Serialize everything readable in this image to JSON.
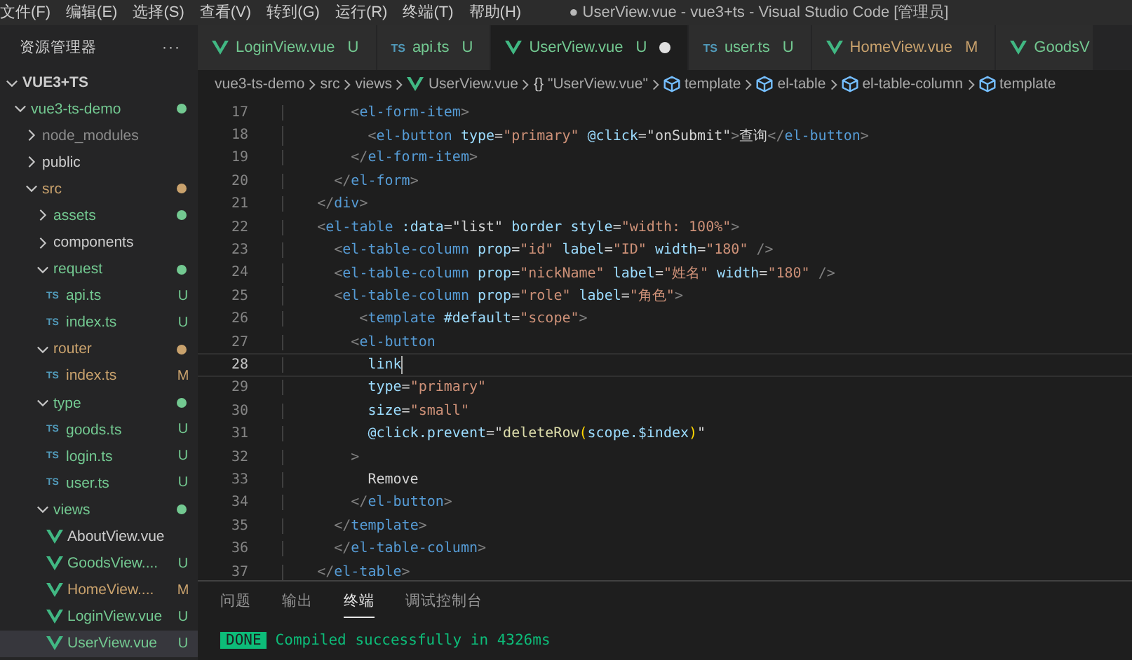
{
  "menu_bar": {
    "items": [
      "文件(F)",
      "编辑(E)",
      "选择(S)",
      "查看(V)",
      "转到(G)",
      "运行(R)",
      "终端(T)",
      "帮助(H)"
    ],
    "window_title": "● UserView.vue - vue3+ts - Visual Studio Code [管理员]"
  },
  "explorer": {
    "title": "资源管理器",
    "more": "···",
    "section": {
      "title": "VUE3+TS",
      "expanded": true
    },
    "tree": [
      {
        "label": "vue3-ts-demo",
        "kind": "folder",
        "expanded": true,
        "dot": true,
        "color": "#73c991",
        "selected": false,
        "children": [
          {
            "label": "node_modules",
            "kind": "folder",
            "expanded": false,
            "dot": false,
            "color": "#8c8c8c",
            "selected": false
          },
          {
            "label": "public",
            "kind": "folder",
            "expanded": false,
            "dot": false,
            "color": "#cccccc",
            "selected": false
          },
          {
            "label": "src",
            "kind": "folder",
            "expanded": true,
            "dot": true,
            "color": "#c9a26d",
            "selected": false,
            "children": [
              {
                "label": "assets",
                "kind": "folder",
                "expanded": false,
                "dot": true,
                "color": "#73c991",
                "selected": false
              },
              {
                "label": "components",
                "kind": "folder",
                "expanded": false,
                "dot": false,
                "color": "#cccccc",
                "selected": false
              },
              {
                "label": "request",
                "kind": "folder",
                "expanded": true,
                "dot": true,
                "color": "#73c991",
                "selected": false,
                "children": [
                  {
                    "label": "api.ts",
                    "kind": "ts",
                    "icon_label": "TS",
                    "badge": "U",
                    "color": "#73c991",
                    "selected": false
                  },
                  {
                    "label": "index.ts",
                    "kind": "ts",
                    "icon_label": "TS",
                    "badge": "U",
                    "color": "#73c991",
                    "selected": false
                  }
                ]
              },
              {
                "label": "router",
                "kind": "folder",
                "expanded": true,
                "dot": true,
                "color": "#c9a26d",
                "selected": false,
                "children": [
                  {
                    "label": "index.ts",
                    "kind": "ts",
                    "icon_label": "TS",
                    "badge": "M",
                    "color": "#c9a26d",
                    "selected": false
                  }
                ]
              },
              {
                "label": "type",
                "kind": "folder",
                "expanded": true,
                "dot": true,
                "color": "#73c991",
                "selected": false,
                "children": [
                  {
                    "label": "goods.ts",
                    "kind": "ts",
                    "icon_label": "TS",
                    "badge": "U",
                    "color": "#73c991",
                    "selected": false
                  },
                  {
                    "label": "login.ts",
                    "kind": "ts",
                    "icon_label": "TS",
                    "badge": "U",
                    "color": "#73c991",
                    "selected": false
                  },
                  {
                    "label": "user.ts",
                    "kind": "ts",
                    "icon_label": "TS",
                    "badge": "U",
                    "color": "#73c991",
                    "selected": false
                  }
                ]
              },
              {
                "label": "views",
                "kind": "folder",
                "expanded": true,
                "dot": true,
                "color": "#73c991",
                "selected": false,
                "children": [
                  {
                    "label": "AboutView.vue",
                    "kind": "vue",
                    "color": "#cccccc",
                    "selected": false
                  },
                  {
                    "label": "GoodsView....",
                    "kind": "vue",
                    "badge": "U",
                    "color": "#73c991",
                    "selected": false
                  },
                  {
                    "label": "HomeView....",
                    "kind": "vue",
                    "badge": "M",
                    "color": "#c9a26d",
                    "selected": false
                  },
                  {
                    "label": "LoginView.vue",
                    "kind": "vue",
                    "badge": "U",
                    "color": "#73c991",
                    "selected": false
                  },
                  {
                    "label": "UserView.vue",
                    "kind": "vue",
                    "badge": "U",
                    "color": "#73c991",
                    "selected": true
                  }
                ]
              }
            ]
          }
        ]
      }
    ]
  },
  "tabs": [
    {
      "label": "LoginView.vue",
      "kind": "vue",
      "badge": "U",
      "color": "#73c991",
      "selected": false,
      "dirty": false
    },
    {
      "label": "api.ts",
      "kind": "ts",
      "icon_label": "TS",
      "badge": "U",
      "color": "#73c991",
      "selected": false,
      "dirty": false
    },
    {
      "label": "UserView.vue",
      "kind": "vue",
      "badge": "U",
      "color": "#73c991",
      "selected": true,
      "dirty": true
    },
    {
      "label": "user.ts",
      "kind": "ts",
      "icon_label": "TS",
      "badge": "U",
      "color": "#73c991",
      "selected": false,
      "dirty": false
    },
    {
      "label": "HomeView.vue",
      "kind": "vue",
      "badge": "M",
      "color": "#c9a26d",
      "selected": false,
      "dirty": false
    },
    {
      "label": "GoodsV",
      "kind": "vue",
      "color": "#73c991",
      "selected": false,
      "dirty": false
    }
  ],
  "breadcrumb": [
    {
      "label": "vue3-ts-demo",
      "kind": "plain"
    },
    {
      "label": "src",
      "kind": "plain"
    },
    {
      "label": "views",
      "kind": "plain"
    },
    {
      "label": "UserView.vue",
      "kind": "vue"
    },
    {
      "label": "\"UserView.vue\"",
      "kind": "object",
      "icon_label": "{}"
    },
    {
      "label": "template",
      "kind": "element"
    },
    {
      "label": "el-table",
      "kind": "element"
    },
    {
      "label": "el-table-column",
      "kind": "element"
    },
    {
      "label": "template",
      "kind": "element"
    }
  ],
  "editor": {
    "lines": [
      {
        "number": "17",
        "current": false,
        "tokens": [
          {
            "kind": "punct",
            "text": "        <"
          },
          {
            "kind": "tag",
            "text": "el-form-item"
          },
          {
            "kind": "punct",
            "text": ">"
          }
        ]
      },
      {
        "number": "18",
        "current": false,
        "tokens": [
          {
            "kind": "punct",
            "text": "          <"
          },
          {
            "kind": "tag",
            "text": "el-button"
          },
          {
            "kind": "attr",
            "text": " type"
          },
          {
            "kind": "text",
            "text": "="
          },
          {
            "kind": "str",
            "text": "\"primary\""
          },
          {
            "kind": "attr",
            "text": " @click"
          },
          {
            "kind": "text",
            "text": "=\"onSubmit\""
          },
          {
            "kind": "punct",
            "text": ">"
          },
          {
            "kind": "text",
            "text": "查询"
          },
          {
            "kind": "punct",
            "text": "</"
          },
          {
            "kind": "tag",
            "text": "el-button"
          },
          {
            "kind": "punct",
            "text": ">"
          }
        ]
      },
      {
        "number": "19",
        "current": false,
        "tokens": [
          {
            "kind": "punct",
            "text": "        </"
          },
          {
            "kind": "tag",
            "text": "el-form-item"
          },
          {
            "kind": "punct",
            "text": ">"
          }
        ]
      },
      {
        "number": "20",
        "current": false,
        "tokens": [
          {
            "kind": "punct",
            "text": "      </"
          },
          {
            "kind": "tag",
            "text": "el-form"
          },
          {
            "kind": "punct",
            "text": ">"
          }
        ]
      },
      {
        "number": "21",
        "current": false,
        "tokens": [
          {
            "kind": "punct",
            "text": "    </"
          },
          {
            "kind": "tag",
            "text": "div"
          },
          {
            "kind": "punct",
            "text": ">"
          }
        ]
      },
      {
        "number": "22",
        "current": false,
        "tokens": [
          {
            "kind": "punct",
            "text": "    <"
          },
          {
            "kind": "tag",
            "text": "el-table"
          },
          {
            "kind": "attr",
            "text": " :data"
          },
          {
            "kind": "text",
            "text": "=\"list\""
          },
          {
            "kind": "attr",
            "text": " border style"
          },
          {
            "kind": "text",
            "text": "="
          },
          {
            "kind": "str",
            "text": "\"width: 100%\""
          },
          {
            "kind": "punct",
            "text": ">"
          }
        ]
      },
      {
        "number": "23",
        "current": false,
        "tokens": [
          {
            "kind": "punct",
            "text": "      <"
          },
          {
            "kind": "tag",
            "text": "el-table-column"
          },
          {
            "kind": "attr",
            "text": " prop"
          },
          {
            "kind": "text",
            "text": "="
          },
          {
            "kind": "str",
            "text": "\"id\""
          },
          {
            "kind": "attr",
            "text": " label"
          },
          {
            "kind": "text",
            "text": "="
          },
          {
            "kind": "str",
            "text": "\"ID\""
          },
          {
            "kind": "attr",
            "text": " width"
          },
          {
            "kind": "text",
            "text": "="
          },
          {
            "kind": "str",
            "text": "\"180\""
          },
          {
            "kind": "punct",
            "text": " />"
          }
        ]
      },
      {
        "number": "24",
        "current": false,
        "tokens": [
          {
            "kind": "punct",
            "text": "      <"
          },
          {
            "kind": "tag",
            "text": "el-table-column"
          },
          {
            "kind": "attr",
            "text": " prop"
          },
          {
            "kind": "text",
            "text": "="
          },
          {
            "kind": "str",
            "text": "\"nickName\""
          },
          {
            "kind": "attr",
            "text": " label"
          },
          {
            "kind": "text",
            "text": "="
          },
          {
            "kind": "str",
            "text": "\"姓名\""
          },
          {
            "kind": "attr",
            "text": " width"
          },
          {
            "kind": "text",
            "text": "="
          },
          {
            "kind": "str",
            "text": "\"180\""
          },
          {
            "kind": "punct",
            "text": " />"
          }
        ]
      },
      {
        "number": "25",
        "current": false,
        "tokens": [
          {
            "kind": "punct",
            "text": "      <"
          },
          {
            "kind": "tag",
            "text": "el-table-column"
          },
          {
            "kind": "attr",
            "text": " prop"
          },
          {
            "kind": "text",
            "text": "="
          },
          {
            "kind": "str",
            "text": "\"role\""
          },
          {
            "kind": "attr",
            "text": " label"
          },
          {
            "kind": "text",
            "text": "="
          },
          {
            "kind": "str",
            "text": "\"角色\""
          },
          {
            "kind": "punct",
            "text": ">"
          }
        ]
      },
      {
        "number": "26",
        "current": false,
        "tokens": [
          {
            "kind": "punct",
            "text": "         <"
          },
          {
            "kind": "tag",
            "text": "template"
          },
          {
            "kind": "attr",
            "text": " #default"
          },
          {
            "kind": "text",
            "text": "="
          },
          {
            "kind": "str",
            "text": "\"scope\""
          },
          {
            "kind": "punct",
            "text": ">"
          }
        ]
      },
      {
        "number": "27",
        "current": false,
        "tokens": [
          {
            "kind": "punct",
            "text": "        <"
          },
          {
            "kind": "tag",
            "text": "el-button"
          }
        ]
      },
      {
        "number": "28",
        "current": true,
        "tokens": [
          {
            "kind": "attr",
            "text": "          link"
          }
        ]
      },
      {
        "number": "29",
        "current": false,
        "tokens": [
          {
            "kind": "attr",
            "text": "          type"
          },
          {
            "kind": "text",
            "text": "="
          },
          {
            "kind": "str",
            "text": "\"primary\""
          }
        ]
      },
      {
        "number": "30",
        "current": false,
        "tokens": [
          {
            "kind": "attr",
            "text": "          size"
          },
          {
            "kind": "text",
            "text": "="
          },
          {
            "kind": "str",
            "text": "\"small\""
          }
        ]
      },
      {
        "number": "31",
        "current": false,
        "tokens": [
          {
            "kind": "attr",
            "text": "          @click.prevent"
          },
          {
            "kind": "text",
            "text": "=\""
          },
          {
            "kind": "fn",
            "text": "deleteRow"
          },
          {
            "kind": "paren",
            "text": "("
          },
          {
            "kind": "var",
            "text": "scope.$index"
          },
          {
            "kind": "paren",
            "text": ")"
          },
          {
            "kind": "text",
            "text": "\""
          }
        ]
      },
      {
        "number": "32",
        "current": false,
        "tokens": [
          {
            "kind": "punct",
            "text": "        >"
          }
        ]
      },
      {
        "number": "33",
        "current": false,
        "tokens": [
          {
            "kind": "text",
            "text": "          Remove"
          }
        ]
      },
      {
        "number": "34",
        "current": false,
        "tokens": [
          {
            "kind": "punct",
            "text": "        </"
          },
          {
            "kind": "tag",
            "text": "el-button"
          },
          {
            "kind": "punct",
            "text": ">"
          }
        ]
      },
      {
        "number": "35",
        "current": false,
        "tokens": [
          {
            "kind": "punct",
            "text": "      </"
          },
          {
            "kind": "tag",
            "text": "template"
          },
          {
            "kind": "punct",
            "text": ">"
          }
        ]
      },
      {
        "number": "36",
        "current": false,
        "tokens": [
          {
            "kind": "punct",
            "text": "      </"
          },
          {
            "kind": "tag",
            "text": "el-table-column"
          },
          {
            "kind": "punct",
            "text": ">"
          }
        ]
      },
      {
        "number": "37",
        "current": false,
        "tokens": [
          {
            "kind": "punct",
            "text": "    </"
          },
          {
            "kind": "tag",
            "text": "el-table"
          },
          {
            "kind": "punct",
            "text": ">"
          }
        ]
      }
    ]
  },
  "panel": {
    "tabs": [
      {
        "label": "问题",
        "selected": false
      },
      {
        "label": "输出",
        "selected": false
      },
      {
        "label": "终端",
        "selected": true
      },
      {
        "label": "调试控制台",
        "selected": false
      }
    ],
    "terminal": {
      "badge": "DONE",
      "message": "Compiled successfully in 4326ms"
    }
  }
}
